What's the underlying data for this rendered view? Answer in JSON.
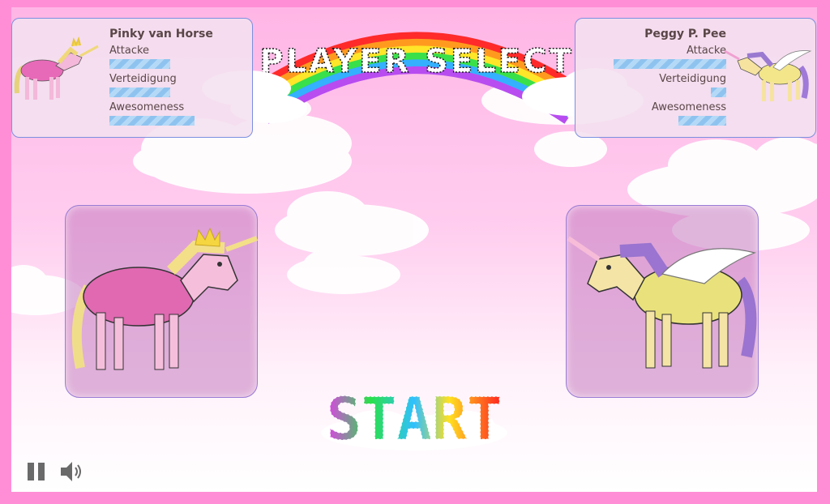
{
  "title": "PLAYER SELECT",
  "player1": {
    "name": "Pinky van Horse",
    "stats": [
      {
        "label": "Attacke",
        "value": 0.5
      },
      {
        "label": "Verteidigung",
        "value": 0.5
      },
      {
        "label": "Awesomeness",
        "value": 0.75
      }
    ]
  },
  "player2": {
    "name": "Peggy P. Pee",
    "stats": [
      {
        "label": "Attacke",
        "value": 0.75
      },
      {
        "label": "Verteidigung",
        "value": 0.12
      },
      {
        "label": "Awesomeness",
        "value": 0.37
      }
    ]
  },
  "start_label": "START",
  "controls": {
    "pause_icon": "pause-icon",
    "sound_icon": "speaker-icon"
  },
  "colors": {
    "background": "#ff8ed6",
    "panel_border": "#7b8fe0",
    "bar": "#8fc3ef",
    "text": "#5a4648"
  }
}
